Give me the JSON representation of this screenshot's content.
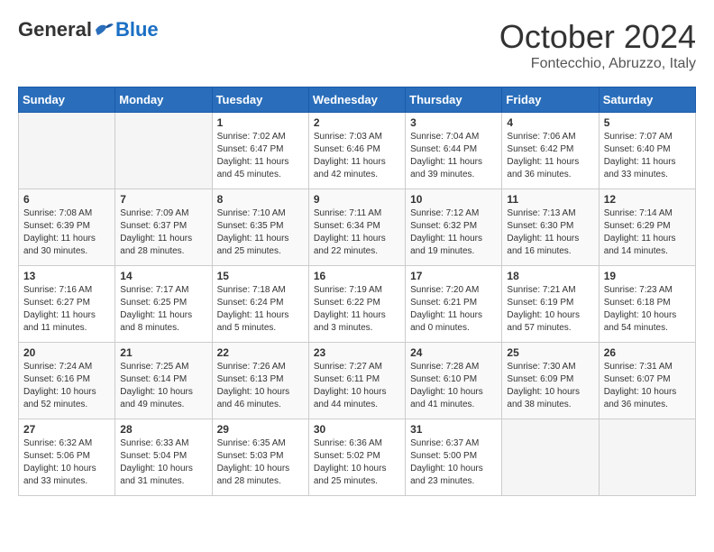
{
  "header": {
    "logo": {
      "general": "General",
      "blue": "Blue"
    },
    "title": "October 2024",
    "location": "Fontecchio, Abruzzo, Italy"
  },
  "calendar": {
    "weekdays": [
      "Sunday",
      "Monday",
      "Tuesday",
      "Wednesday",
      "Thursday",
      "Friday",
      "Saturday"
    ],
    "weeks": [
      [
        {
          "day": "",
          "info": ""
        },
        {
          "day": "",
          "info": ""
        },
        {
          "day": "1",
          "info": "Sunrise: 7:02 AM\nSunset: 6:47 PM\nDaylight: 11 hours and 45 minutes."
        },
        {
          "day": "2",
          "info": "Sunrise: 7:03 AM\nSunset: 6:46 PM\nDaylight: 11 hours and 42 minutes."
        },
        {
          "day": "3",
          "info": "Sunrise: 7:04 AM\nSunset: 6:44 PM\nDaylight: 11 hours and 39 minutes."
        },
        {
          "day": "4",
          "info": "Sunrise: 7:06 AM\nSunset: 6:42 PM\nDaylight: 11 hours and 36 minutes."
        },
        {
          "day": "5",
          "info": "Sunrise: 7:07 AM\nSunset: 6:40 PM\nDaylight: 11 hours and 33 minutes."
        }
      ],
      [
        {
          "day": "6",
          "info": "Sunrise: 7:08 AM\nSunset: 6:39 PM\nDaylight: 11 hours and 30 minutes."
        },
        {
          "day": "7",
          "info": "Sunrise: 7:09 AM\nSunset: 6:37 PM\nDaylight: 11 hours and 28 minutes."
        },
        {
          "day": "8",
          "info": "Sunrise: 7:10 AM\nSunset: 6:35 PM\nDaylight: 11 hours and 25 minutes."
        },
        {
          "day": "9",
          "info": "Sunrise: 7:11 AM\nSunset: 6:34 PM\nDaylight: 11 hours and 22 minutes."
        },
        {
          "day": "10",
          "info": "Sunrise: 7:12 AM\nSunset: 6:32 PM\nDaylight: 11 hours and 19 minutes."
        },
        {
          "day": "11",
          "info": "Sunrise: 7:13 AM\nSunset: 6:30 PM\nDaylight: 11 hours and 16 minutes."
        },
        {
          "day": "12",
          "info": "Sunrise: 7:14 AM\nSunset: 6:29 PM\nDaylight: 11 hours and 14 minutes."
        }
      ],
      [
        {
          "day": "13",
          "info": "Sunrise: 7:16 AM\nSunset: 6:27 PM\nDaylight: 11 hours and 11 minutes."
        },
        {
          "day": "14",
          "info": "Sunrise: 7:17 AM\nSunset: 6:25 PM\nDaylight: 11 hours and 8 minutes."
        },
        {
          "day": "15",
          "info": "Sunrise: 7:18 AM\nSunset: 6:24 PM\nDaylight: 11 hours and 5 minutes."
        },
        {
          "day": "16",
          "info": "Sunrise: 7:19 AM\nSunset: 6:22 PM\nDaylight: 11 hours and 3 minutes."
        },
        {
          "day": "17",
          "info": "Sunrise: 7:20 AM\nSunset: 6:21 PM\nDaylight: 11 hours and 0 minutes."
        },
        {
          "day": "18",
          "info": "Sunrise: 7:21 AM\nSunset: 6:19 PM\nDaylight: 10 hours and 57 minutes."
        },
        {
          "day": "19",
          "info": "Sunrise: 7:23 AM\nSunset: 6:18 PM\nDaylight: 10 hours and 54 minutes."
        }
      ],
      [
        {
          "day": "20",
          "info": "Sunrise: 7:24 AM\nSunset: 6:16 PM\nDaylight: 10 hours and 52 minutes."
        },
        {
          "day": "21",
          "info": "Sunrise: 7:25 AM\nSunset: 6:14 PM\nDaylight: 10 hours and 49 minutes."
        },
        {
          "day": "22",
          "info": "Sunrise: 7:26 AM\nSunset: 6:13 PM\nDaylight: 10 hours and 46 minutes."
        },
        {
          "day": "23",
          "info": "Sunrise: 7:27 AM\nSunset: 6:11 PM\nDaylight: 10 hours and 44 minutes."
        },
        {
          "day": "24",
          "info": "Sunrise: 7:28 AM\nSunset: 6:10 PM\nDaylight: 10 hours and 41 minutes."
        },
        {
          "day": "25",
          "info": "Sunrise: 7:30 AM\nSunset: 6:09 PM\nDaylight: 10 hours and 38 minutes."
        },
        {
          "day": "26",
          "info": "Sunrise: 7:31 AM\nSunset: 6:07 PM\nDaylight: 10 hours and 36 minutes."
        }
      ],
      [
        {
          "day": "27",
          "info": "Sunrise: 6:32 AM\nSunset: 5:06 PM\nDaylight: 10 hours and 33 minutes."
        },
        {
          "day": "28",
          "info": "Sunrise: 6:33 AM\nSunset: 5:04 PM\nDaylight: 10 hours and 31 minutes."
        },
        {
          "day": "29",
          "info": "Sunrise: 6:35 AM\nSunset: 5:03 PM\nDaylight: 10 hours and 28 minutes."
        },
        {
          "day": "30",
          "info": "Sunrise: 6:36 AM\nSunset: 5:02 PM\nDaylight: 10 hours and 25 minutes."
        },
        {
          "day": "31",
          "info": "Sunrise: 6:37 AM\nSunset: 5:00 PM\nDaylight: 10 hours and 23 minutes."
        },
        {
          "day": "",
          "info": ""
        },
        {
          "day": "",
          "info": ""
        }
      ]
    ]
  }
}
